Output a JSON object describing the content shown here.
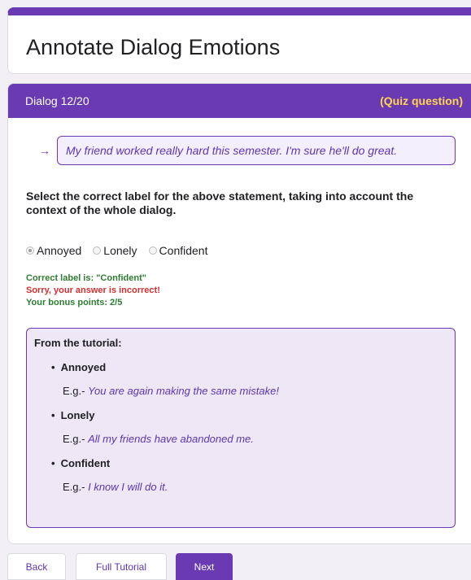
{
  "page": {
    "title": "Annotate Dialog Emotions"
  },
  "header": {
    "dialog_counter": "Dialog 12/20",
    "quiz_tag": "(Quiz question)"
  },
  "statement": {
    "arrow": "→",
    "text": "My friend worked really hard this semester. I'm sure he'll do great."
  },
  "instruction": "Select the correct label for the above statement, taking into account the context of the whole dialog.",
  "options": [
    {
      "label": "Annoyed",
      "selected": true
    },
    {
      "label": "Lonely",
      "selected": false
    },
    {
      "label": "Confident",
      "selected": false
    }
  ],
  "feedback": {
    "correct_label": "Correct label is: \"Confident\"",
    "result": "Sorry, your answer is incorrect!",
    "bonus": "Your bonus points: 2/5"
  },
  "tutorial": {
    "title": "From the tutorial:",
    "example_prefix": "E.g.-",
    "items": [
      {
        "label": "Annoyed",
        "example": "You are again making the same mistake!"
      },
      {
        "label": "Lonely",
        "example": "All my friends have abandoned me."
      },
      {
        "label": "Confident",
        "example": "I know I will do it."
      }
    ]
  },
  "buttons": {
    "back": "Back",
    "full_tutorial": "Full Tutorial",
    "next": "Next"
  },
  "colors": {
    "accent": "#6a3ab2",
    "quiz_tag": "#ffd54f",
    "correct": "#2e7d32",
    "incorrect": "#d32f2f",
    "example_text": "#5e35b1"
  }
}
